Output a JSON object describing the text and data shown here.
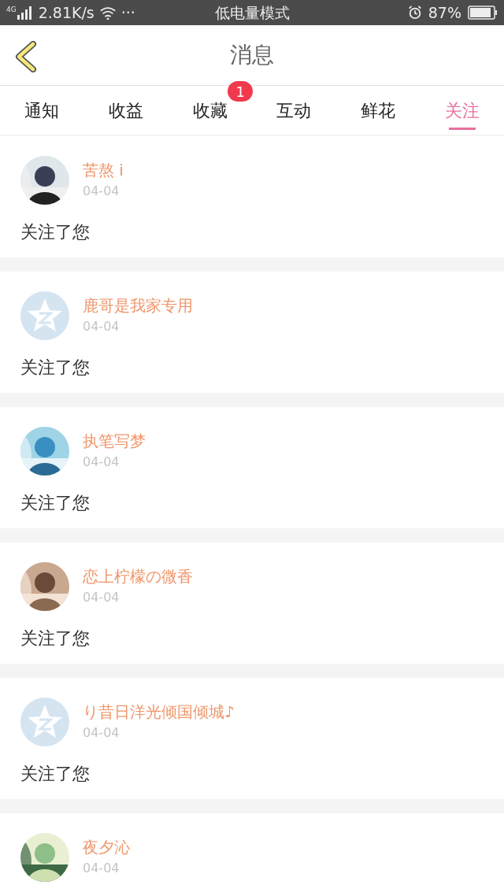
{
  "status_bar": {
    "network": "4G",
    "speed": "2.81K/s",
    "more": "···",
    "mode": "低电量模式",
    "battery": "87%"
  },
  "header": {
    "title": "消息"
  },
  "tabs": [
    {
      "label": "通知",
      "selected": false
    },
    {
      "label": "收益",
      "selected": false
    },
    {
      "label": "收藏",
      "selected": false,
      "badge": "1"
    },
    {
      "label": "互动",
      "selected": false
    },
    {
      "label": "鲜花",
      "selected": false
    },
    {
      "label": "关注",
      "selected": true
    }
  ],
  "messages": [
    {
      "name": "苦熬 i",
      "date": "04-04",
      "text": "关注了您"
    },
    {
      "avatar": {
        "kind": "default"
      },
      "name": "鹿哥是我家专用",
      "date": "04-04",
      "text": "关注了您"
    },
    {
      "name": "执笔写梦",
      "date": "04-04",
      "text": "关注了您"
    },
    {
      "name": "恋上柠檬の微香",
      "date": "04-04",
      "text": "关注了您"
    },
    {
      "avatar": {
        "kind": "default"
      },
      "name": "り昔日洋光倾国倾城♪",
      "date": "04-04",
      "text": "关注了您"
    },
    {
      "name": "夜夕沁",
      "date": "04-04"
    }
  ]
}
